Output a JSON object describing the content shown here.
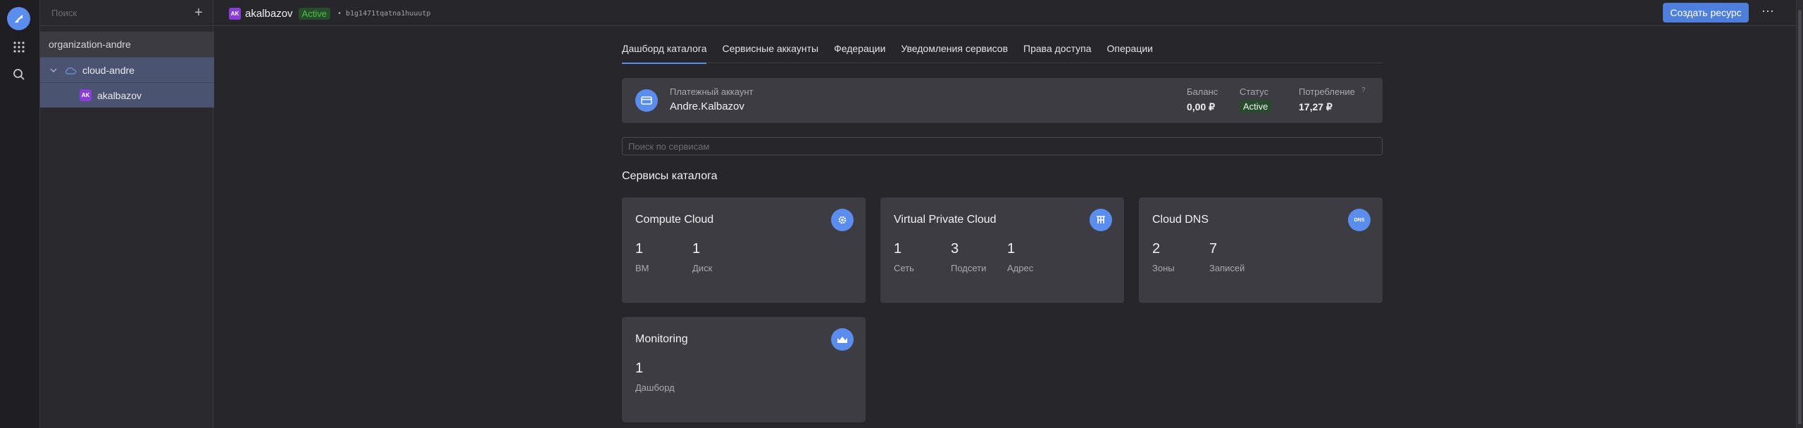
{
  "sidebar": {
    "search_placeholder": "Поиск",
    "org": "organization-andre",
    "cloud": "cloud-andre",
    "folder_avatar": "AK",
    "folder": "akalbazov"
  },
  "header": {
    "avatar": "AK",
    "name": "akalbazov",
    "status": "Active",
    "id": "• b1g1471tqatna1huuutp",
    "create_button": "Создать ресурс",
    "more": "⋯"
  },
  "tabs": [
    {
      "label": "Дашборд каталога",
      "active": true
    },
    {
      "label": "Сервисные аккаунты"
    },
    {
      "label": "Федерации"
    },
    {
      "label": "Уведомления сервисов"
    },
    {
      "label": "Права доступа"
    },
    {
      "label": "Операции"
    }
  ],
  "billing": {
    "label": "Платежный аккаунт",
    "account": "Andre.Kalbazov",
    "balance_label": "Баланс",
    "balance": "0,00 ₽",
    "status_label": "Статус",
    "status": "Active",
    "usage_label": "Потребление",
    "usage": "17,27 ₽"
  },
  "search": {
    "placeholder": "Поиск по сервисам"
  },
  "section_title": "Сервисы каталога",
  "cards": [
    {
      "title": "Compute Cloud",
      "icon": "gear-icon",
      "metrics": [
        {
          "num": "1",
          "lbl": "ВМ"
        },
        {
          "num": "1",
          "lbl": "Диск"
        }
      ]
    },
    {
      "title": "Virtual Private Cloud",
      "icon": "network-icon",
      "metrics": [
        {
          "num": "1",
          "lbl": "Сеть"
        },
        {
          "num": "3",
          "lbl": "Подсети"
        },
        {
          "num": "1",
          "lbl": "Адрес"
        }
      ]
    },
    {
      "title": "Cloud DNS",
      "icon": "dns-icon",
      "icon_text": "DNS",
      "metrics": [
        {
          "num": "2",
          "lbl": "Зоны"
        },
        {
          "num": "7",
          "lbl": "Записей"
        }
      ]
    },
    {
      "title": "Monitoring",
      "icon": "chart-icon",
      "metrics": [
        {
          "num": "1",
          "lbl": "Дашборд"
        }
      ]
    }
  ],
  "colors": {
    "accent": "#5b8dee",
    "active_green": "#4fc04c",
    "avatar_purple": "#8b3dd9"
  }
}
